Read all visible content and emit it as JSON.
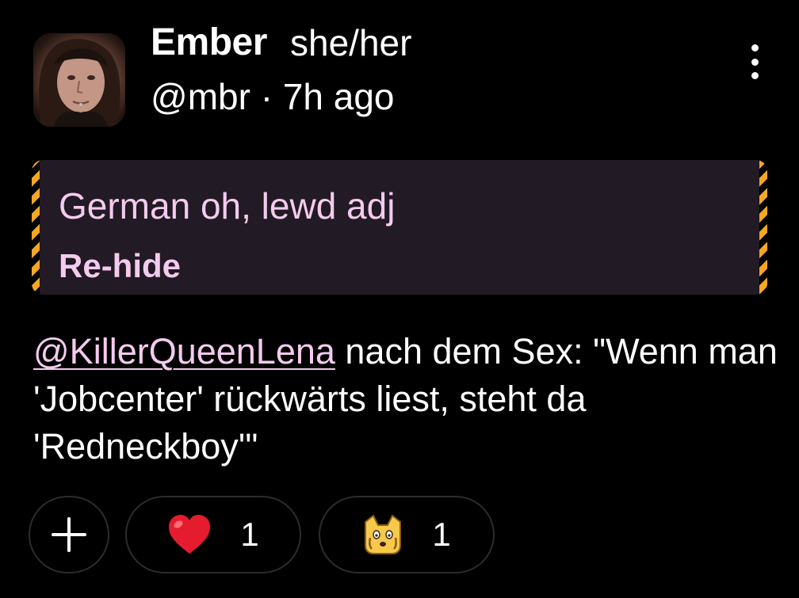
{
  "author": {
    "display_name": "Ember",
    "pronouns": "she/her",
    "handle": "@mbr",
    "separator": "·",
    "time_ago": "7h ago"
  },
  "content_warning": {
    "text": "German oh, lewd adj",
    "toggle_label": "Re-hide",
    "accent_color": "#f5a623",
    "text_color": "#f3cbee"
  },
  "post": {
    "mention": "@KillerQueenLena",
    "text": " nach dem Sex: \"Wenn man 'Jobcenter' rückwärts liest, steht da 'Redneckboy'\""
  },
  "reactions": {
    "add_icon": "plus-icon",
    "items": [
      {
        "icon": "heart-emoji",
        "count": "1"
      },
      {
        "icon": "shocked-cat-emoji",
        "count": "1"
      }
    ]
  },
  "menu_icon": "more-vertical-icon"
}
